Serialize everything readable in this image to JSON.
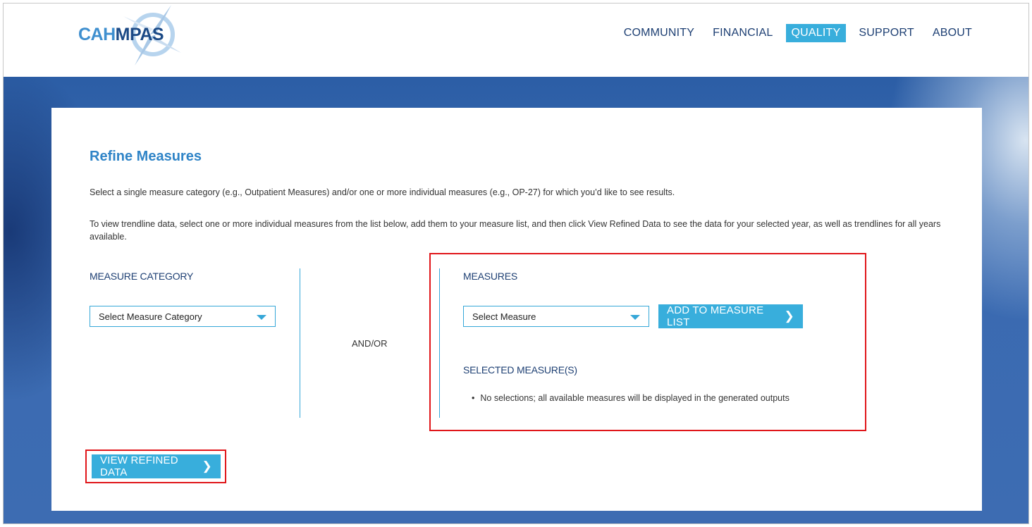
{
  "header": {
    "logo": {
      "part1": "CAH",
      "part2": "MPAS"
    },
    "nav": [
      {
        "label": "COMMUNITY",
        "active": false
      },
      {
        "label": "FINANCIAL",
        "active": false
      },
      {
        "label": "QUALITY",
        "active": true
      },
      {
        "label": "SUPPORT",
        "active": false
      },
      {
        "label": "ABOUT",
        "active": false
      }
    ]
  },
  "main": {
    "title": "Refine Measures",
    "description1": "Select a single measure category (e.g., Outpatient Measures) and/or one or more individual measures (e.g., OP-27) for which you’d like to see results.",
    "description2": "To view trendline data, select one or more individual measures from the list below, add them to your measure list, and then click View Refined Data to see the data for your selected year, as well as trendlines for all years available.",
    "category": {
      "label": "MEASURE CATEGORY",
      "select_value": "Select Measure Category"
    },
    "andor": "AND/OR",
    "measures": {
      "label": "MEASURES",
      "select_value": "Select Measure",
      "add_button": "ADD TO MEASURE LIST",
      "selected_label": "SELECTED MEASURE(S)",
      "selected_items": [
        "No selections; all available measures will be displayed in the generated outputs"
      ]
    },
    "view_button": "VIEW REFINED DATA"
  },
  "colors": {
    "accent": "#38aedc",
    "navy": "#1d3f73",
    "title_blue": "#2f84c7",
    "highlight_red": "#e0161a",
    "band_blue": "#3a6ab1"
  }
}
